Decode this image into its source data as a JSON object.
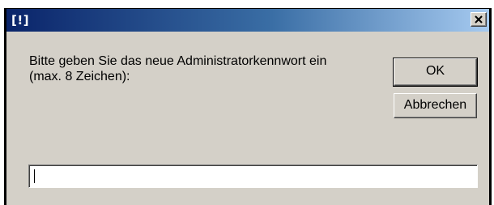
{
  "window": {
    "title": "[!]"
  },
  "dialog": {
    "prompt": "Bitte geben Sie das neue Administratorkennwort ein\n(max. 8 Zeichen):",
    "ok_label": "OK",
    "cancel_label": "Abbrechen",
    "password_value": ""
  },
  "icons": {
    "close": "close-icon"
  }
}
